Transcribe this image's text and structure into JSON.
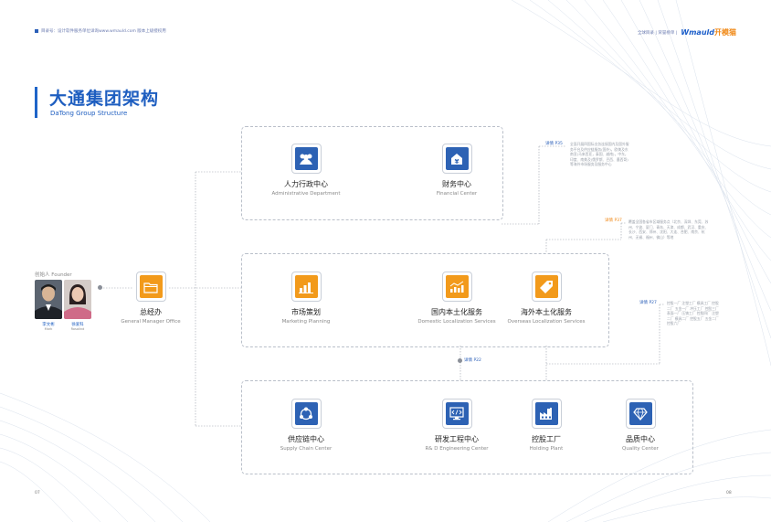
{
  "header": {
    "left_text": "目录号：设计软件服务单位详询www.wmauld.com 版本上级授权用",
    "nav": "全球目录 | 荣誉榜单 |",
    "logo_en": "Wmauld",
    "logo_cn": "开模猫"
  },
  "title": "大通集团架构",
  "subtitle": "DaTong Group Structure",
  "founder": {
    "label": "创始人 Founder",
    "persons": [
      {
        "name": "李文彬",
        "role": "Mark"
      },
      {
        "name": "徐爱科",
        "role": "Rosalind"
      }
    ]
  },
  "gm": {
    "cn": "总经办",
    "en": "General Manager Office"
  },
  "top": [
    {
      "cn": "人力行政中心",
      "en": "Administrative Department"
    },
    {
      "cn": "财务中心",
      "en": "Financial Center"
    }
  ],
  "mid": [
    {
      "cn": "市场策划",
      "en": "Marketing Planning"
    },
    {
      "cn": "国内本土化服务",
      "en": "Domestic Localization Services"
    },
    {
      "cn": "海外本土化服务",
      "en": "Overseas Localization Services"
    }
  ],
  "bottom": [
    {
      "cn": "供应链中心",
      "en": "Supply Chain Center"
    },
    {
      "cn": "研发工程中心",
      "en": "R& D Engineering Center"
    },
    {
      "cn": "控股工厂",
      "en": "Holding Plant"
    },
    {
      "cn": "品质中心",
      "en": "Quality Center"
    }
  ],
  "tags": {
    "t1_a": "详情",
    "t1_b": "P35",
    "t2_a": "详情",
    "t2_b": "P37",
    "t3_a": "详情",
    "t3_b": "P27",
    "t4_a": "详情",
    "t4_b": "P22"
  },
  "notes": {
    "n1": "全面开展四国际业务连接国内及国外服务平台及供应链服务(国外)，欧美及东南亚(马来西亚，泰国、越南)，中东，印度、南美及(俄罗斯、巴西、墨西哥)等海外市场服务及服务中心",
    "n2": "覆盖全国各省市区域服务点（北京、深圳、东莞、苏州、宁波、厦门、青岛、天津、成都、武汉、重庆、长沙、西安、郑州、沈阳、大连、合肥、南京、杭州、无锡、福州、佛山）等地",
    "n3": "控股一厂 注塑工厂 模具工厂 控股二厂 五金一厂 冲压工厂 控股三厂 表面一厂 压铸工厂 控股四厂 注塑二厂 模具二厂 控股五厂 五金二厂 控股六厂"
  },
  "pages": {
    "left": "07",
    "right": "08"
  }
}
